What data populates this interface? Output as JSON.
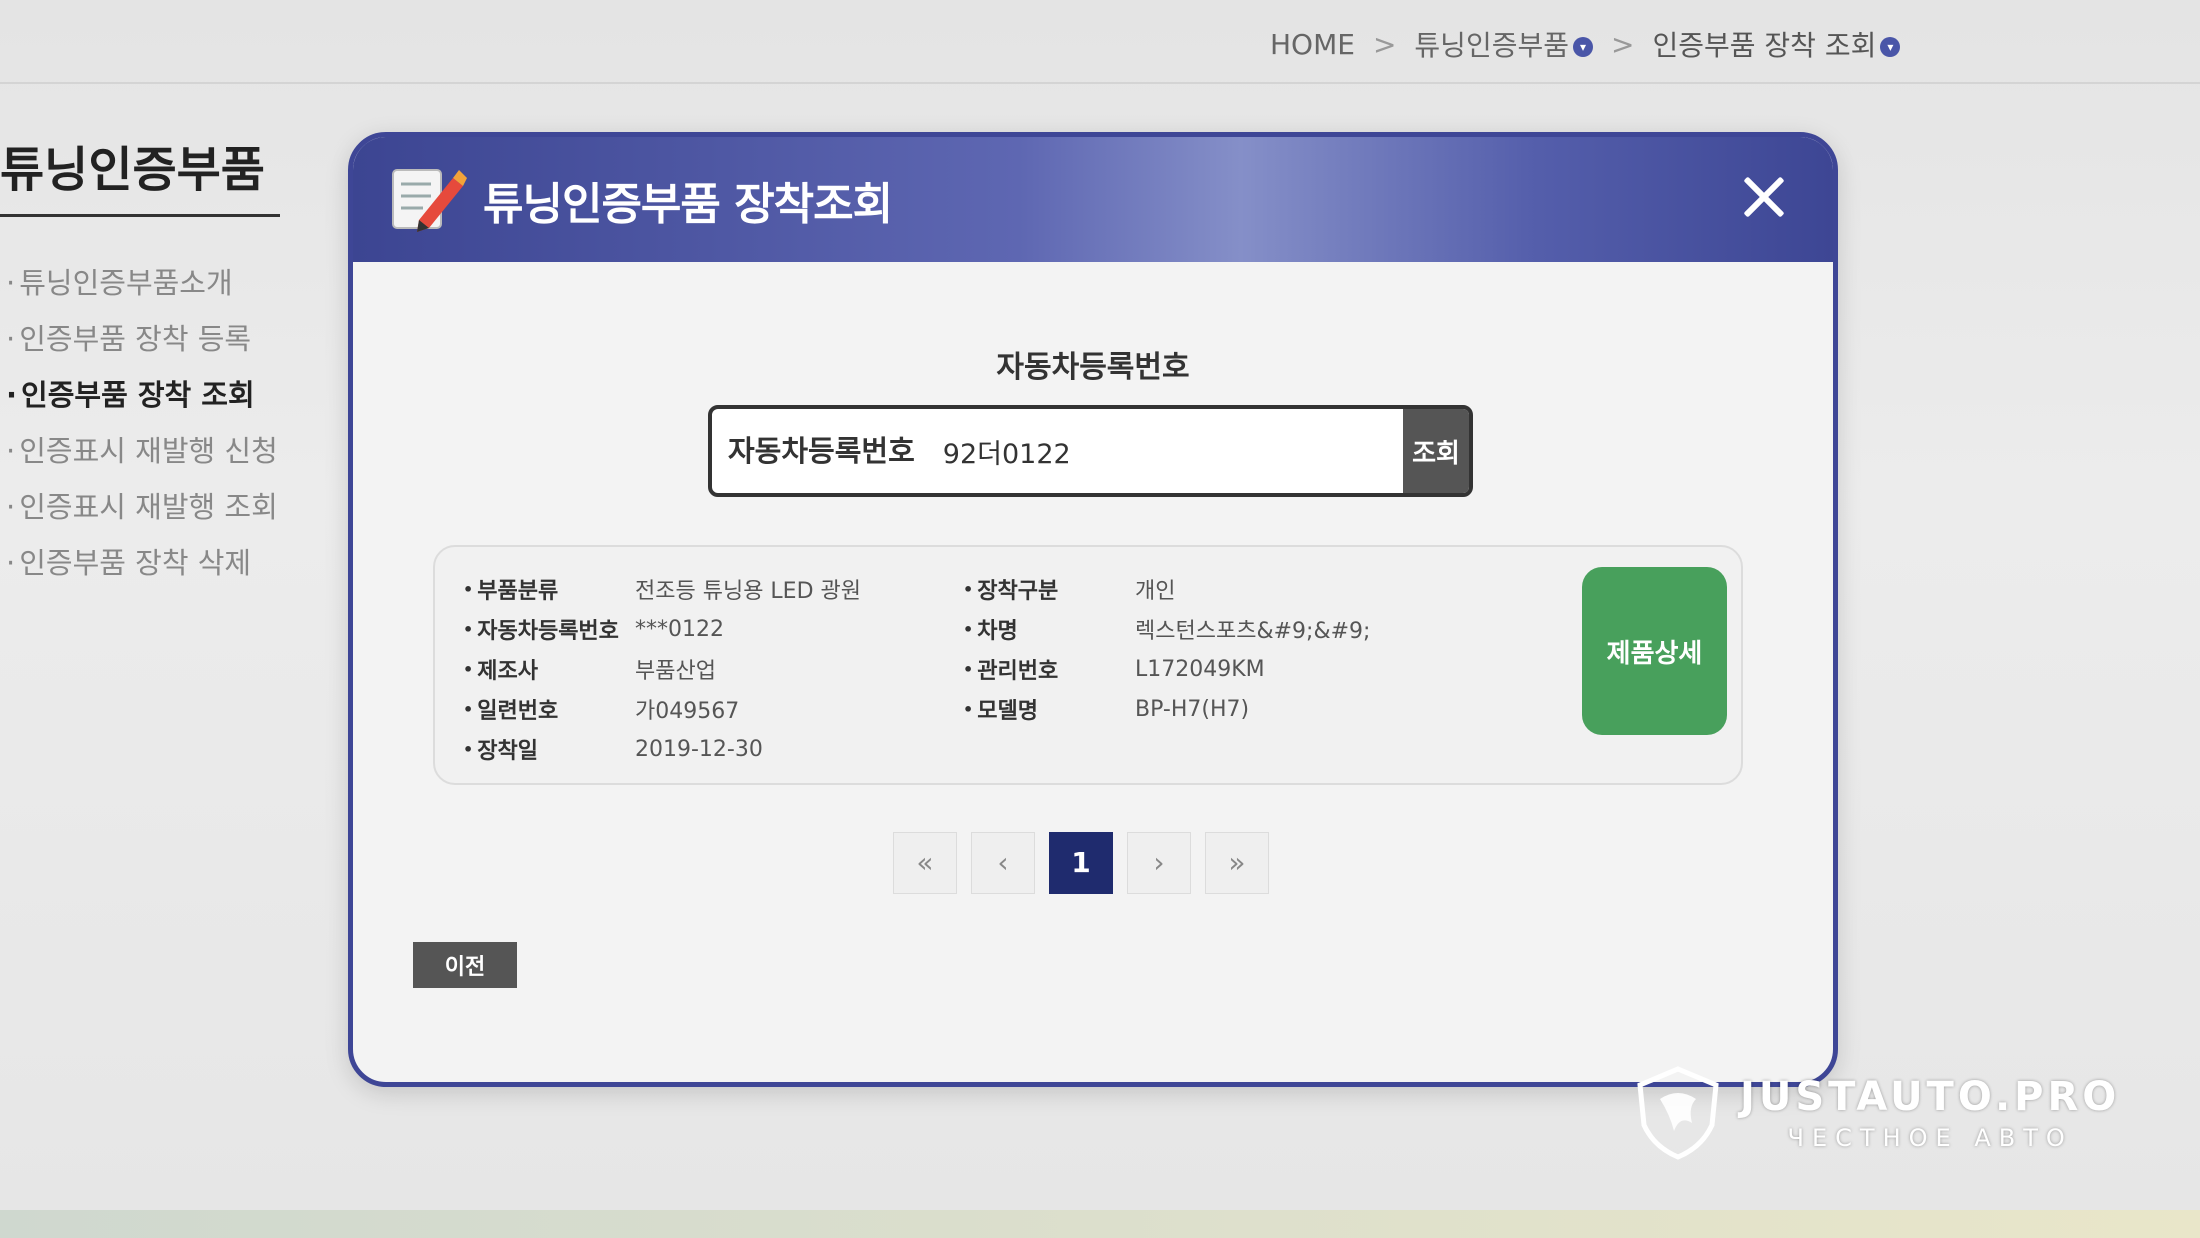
{
  "breadcrumb": {
    "home": "HOME",
    "separator": ">",
    "level1": "튜닝인증부품",
    "level2": "인증부품 장착 조회"
  },
  "sidebar": {
    "title": "튜닝인증부품",
    "items": [
      {
        "label": "튜닝인증부품소개"
      },
      {
        "label": "인증부품 장착 등록"
      },
      {
        "label": "인증부품 장착 조회"
      },
      {
        "label": "인증표시 재발행 신청"
      },
      {
        "label": "인증표시 재발행 조회"
      },
      {
        "label": "인증부품 장착 삭제"
      }
    ]
  },
  "modal": {
    "title": "튜닝인증부품 장착조회",
    "search": {
      "heading": "자동차등록번호",
      "label": "자동차등록번호",
      "value": "92더0122",
      "button": "조회"
    },
    "result": {
      "left": [
        {
          "label": "부품분류",
          "value": "전조등 튜닝용 LED 광원"
        },
        {
          "label": "자동차등록번호",
          "value": "***0122"
        },
        {
          "label": "제조사",
          "value": "부품산업"
        },
        {
          "label": "일련번호",
          "value": "가049567"
        },
        {
          "label": "장착일",
          "value": "2019-12-30"
        }
      ],
      "right": [
        {
          "label": "장착구분",
          "value": "개인"
        },
        {
          "label": "차명",
          "value": "렉스턴스포츠&#9;&#9;"
        },
        {
          "label": "관리번호",
          "value": "L172049KM"
        },
        {
          "label": "모델명",
          "value": "BP-H7(H7)"
        }
      ],
      "detail_button": "제품상세"
    },
    "pagination": {
      "first": "«",
      "prev": "‹",
      "current": "1",
      "next": "›",
      "last": "»"
    },
    "back_button": "이전"
  },
  "watermark": {
    "brand": "JUSTAUTO.PRO",
    "tagline": "ЧЕСТНОЕ АВТО"
  },
  "colors": {
    "header_accent": "#3e4696",
    "detail_green": "#48a05c",
    "page_active": "#1f2b6e"
  }
}
